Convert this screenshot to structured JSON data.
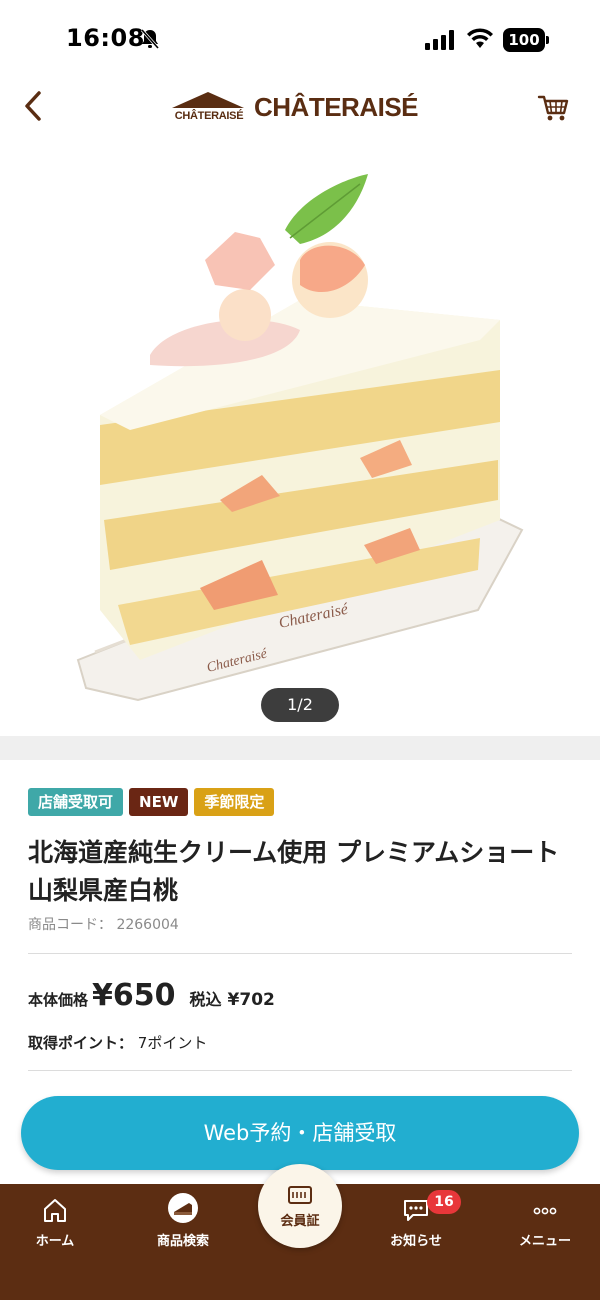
{
  "status_bar": {
    "time": "16:08",
    "battery": "100"
  },
  "header": {
    "brand_mark": "CHÂTERAISÉ",
    "brand": "CHÂTERAISÉ"
  },
  "gallery": {
    "pager": "1/2"
  },
  "product": {
    "tags": [
      {
        "label": "店舗受取可",
        "color": "#3fa8a8"
      },
      {
        "label": "NEW",
        "color": "#6a2614"
      },
      {
        "label": "季節限定",
        "color": "#d9a116"
      }
    ],
    "title": "北海道産純生クリーム使用 プレミアムショート 山梨県産白桃",
    "code_label": "商品コード：",
    "code": "2266004",
    "price_label": "本体価格",
    "price": "¥650",
    "tax_label": "税込",
    "price_tax": "¥702",
    "points_label": "取得ポイント：",
    "points": "7ポイント"
  },
  "cta": {
    "label": "Web予約・店舗受取",
    "color": "#22aed0"
  },
  "bottom_nav": {
    "home": "ホーム",
    "search": "商品検索",
    "member": "会員証",
    "news": "お知らせ",
    "news_badge": "16",
    "menu": "メニュー",
    "background": "#5c2d12"
  },
  "icons": [
    "back-icon",
    "cart-icon",
    "bell-off-icon",
    "signal-icon",
    "wifi-icon",
    "home-icon",
    "cake-icon",
    "member-card-icon",
    "chat-icon",
    "more-icon"
  ]
}
